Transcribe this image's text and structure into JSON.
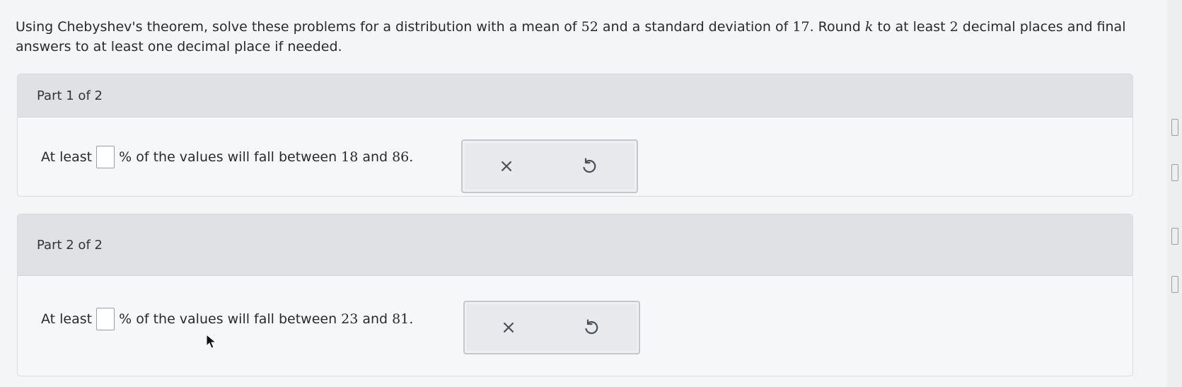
{
  "intro": {
    "text_a": "Using Chebyshev's theorem, solve these problems for a distribution with a mean of ",
    "mean": "52",
    "text_b": " and a standard deviation of ",
    "sd": "17",
    "text_c": ". Round ",
    "k": "k",
    "text_d": " to at least ",
    "two": "2",
    "text_e": " decimal places and final answers to at least one decimal place if needed."
  },
  "part1": {
    "header": "Part 1 of 2",
    "prefix": "At least",
    "suffix": "% of the values will fall between",
    "low": "18",
    "and": "and",
    "high": "86",
    "period": ".",
    "answer_value": ""
  },
  "part2": {
    "header": "Part 2 of 2",
    "prefix": "At least",
    "suffix": "% of the values will fall between",
    "low": "23",
    "and": "and",
    "high": "81",
    "period": ".",
    "answer_value": ""
  },
  "controls": {
    "clear_icon": "close-icon",
    "clear_glyph": "×",
    "undo_icon": "undo-icon"
  }
}
